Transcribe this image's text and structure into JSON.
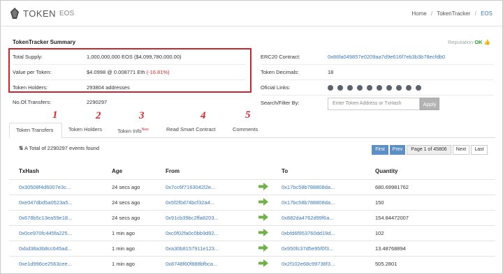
{
  "header": {
    "logo_text": "TOKEN",
    "logo_sub": "EOS",
    "breadcrumb": [
      "Home",
      "TokenTracker",
      "EOS"
    ]
  },
  "summary": {
    "title": "TokenTracker Summary",
    "reputation_label": "Reputation",
    "reputation_value": "OK",
    "left": [
      {
        "label": "Total Supply:",
        "value": "1,000,000,000 EOS ($4,099,780,000.00)"
      },
      {
        "label": "Value per Token:",
        "value": "$4.0998 @ 0.008771 Eth",
        "change": "(-16.81%)"
      },
      {
        "label": "Token Holders:",
        "value": "293804 addresses"
      },
      {
        "label": "No.Of.Transfers:",
        "value": "2290297"
      }
    ],
    "right": [
      {
        "label": "ERC20 Contract:",
        "value": "0x86fa049857e0209aa7d9e616f7eb3b3b78ecfdb0"
      },
      {
        "label": "Token Decimals:",
        "value": "18"
      },
      {
        "label": "Oficial Links:",
        "value": ""
      },
      {
        "label": "Search/Filter By:",
        "value": ""
      }
    ],
    "social_icons": [
      "globe-icon",
      "mail-icon",
      "book-icon",
      "facebook-icon",
      "twitter-icon",
      "github-icon",
      "reddit-icon",
      "wechat-icon",
      "telegram-icon",
      "steemit-icon"
    ],
    "filter_placeholder": "Enter Token Address or TxHash",
    "apply_label": "Apply"
  },
  "annotations": [
    "1",
    "2",
    "3",
    "4",
    "5"
  ],
  "tabs": [
    {
      "label": "Token Transfers",
      "badge": ""
    },
    {
      "label": "Token Holders",
      "badge": ""
    },
    {
      "label": "Token Info",
      "badge": "New"
    },
    {
      "label": "Read Smart Contract",
      "badge": ""
    },
    {
      "label": "Comments",
      "badge": ""
    }
  ],
  "transfers": {
    "summary": "A Total of 2290297 events found",
    "pager": {
      "first": "First",
      "prev": "Prev",
      "page_text": "Page 1 of 45806",
      "next": "Next",
      "last": "Last"
    },
    "columns": [
      "TxHash",
      "Age",
      "From",
      "To",
      "Quantity"
    ],
    "rows": [
      {
        "hash": "0x30508f4d6007e3c...",
        "age": "24 secs ago",
        "from": "0x7cc6f7163042l2e...",
        "to": "0x17bc58b788808da...",
        "qty": "680.69981762"
      },
      {
        "hash": "0xe047dbd5a0523a5...",
        "age": "24 secs ago",
        "from": "0x5f2f0d74bcf32a4...",
        "to": "0x17bc58b788808da...",
        "qty": "150"
      },
      {
        "hash": "0x678b5c13ea59e18...",
        "age": "24 secs ago",
        "from": "0x91cb39bc2ffa8203...",
        "to": "0x882da4762d99f6a...",
        "qty": "154.84472007"
      },
      {
        "hash": "0x0ce970fc445fa225...",
        "age": "1 min ago",
        "from": "0xc0f02fa0c0bb9d92...",
        "to": "0xbfd6f953760dd19d...",
        "qty": "102"
      },
      {
        "hash": "0xbd38a3b8cc645ad...",
        "age": "1 min ago",
        "from": "0xa30b8157911e123...",
        "to": "0x950fc37d5e95f0f3...",
        "qty": "13.48768894"
      },
      {
        "hash": "0xe1d996ce2563cee...",
        "age": "1 min ago",
        "from": "0x8748f60f888bfbca...",
        "to": "0x2f102e68c99736f3...",
        "qty": "505.2801"
      }
    ]
  }
}
